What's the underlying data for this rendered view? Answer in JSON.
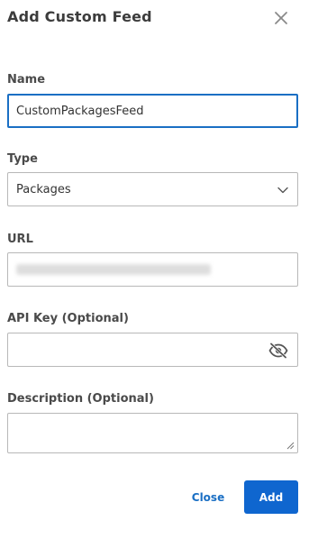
{
  "dialog": {
    "title": "Add Custom Feed",
    "close_icon": "close-icon"
  },
  "fields": {
    "name": {
      "label": "Name",
      "value": "CustomPackagesFeed"
    },
    "type": {
      "label": "Type",
      "value": "Packages",
      "icon": "chevron-down-icon"
    },
    "url": {
      "label": "URL",
      "value": ""
    },
    "api_key": {
      "label": "API Key (Optional)",
      "value": "",
      "icon": "eye-off-icon"
    },
    "description": {
      "label": "Description (Optional)",
      "value": ""
    }
  },
  "actions": {
    "close_label": "Close",
    "add_label": "Add"
  },
  "colors": {
    "accent": "#0f66cf",
    "focus_border": "#1a6fc4",
    "field_border": "#b8b8b8"
  }
}
